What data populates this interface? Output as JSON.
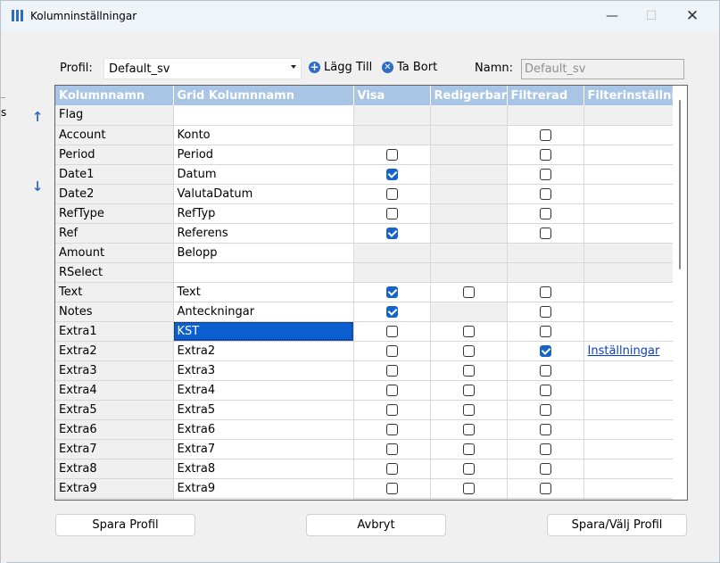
{
  "window": {
    "title": "Kolumninställningar",
    "min_glyph": "—",
    "max_glyph": "☐",
    "close_glyph": "✕"
  },
  "toolbar": {
    "profile_label": "Profil:",
    "profile_value": "Default_sv",
    "add_label": "Lägg Till",
    "remove_label": "Ta Bort",
    "name_label": "Namn:",
    "name_value": "Default_sv"
  },
  "side": {
    "up_glyph": "↑",
    "down_glyph": "↓",
    "strip_glyph": "s"
  },
  "grid": {
    "columns": [
      "Kolumnnamn",
      "Grid Kolumnnamn",
      "Visa",
      "Redigerbar",
      "Filtrerad",
      "Filterinställningar"
    ],
    "rows": [
      {
        "name": "Flag",
        "grid": "",
        "visa": null,
        "redig": null,
        "filt": null,
        "settings": ""
      },
      {
        "name": "Account",
        "grid": "Konto",
        "visa": null,
        "redig": null,
        "filt": false,
        "settings": ""
      },
      {
        "name": "Period",
        "grid": "Period",
        "visa": false,
        "redig": null,
        "filt": false,
        "settings": ""
      },
      {
        "name": "Date1",
        "grid": "Datum",
        "visa": true,
        "redig": null,
        "filt": false,
        "settings": ""
      },
      {
        "name": "Date2",
        "grid": "ValutaDatum",
        "visa": false,
        "redig": null,
        "filt": false,
        "settings": ""
      },
      {
        "name": "RefType",
        "grid": "RefTyp",
        "visa": false,
        "redig": null,
        "filt": false,
        "settings": ""
      },
      {
        "name": "Ref",
        "grid": "Referens",
        "visa": true,
        "redig": null,
        "filt": false,
        "settings": ""
      },
      {
        "name": "Amount",
        "grid": "Belopp",
        "visa": null,
        "redig": null,
        "filt": null,
        "settings": ""
      },
      {
        "name": "RSelect",
        "grid": "",
        "visa": null,
        "redig": null,
        "filt": null,
        "settings": ""
      },
      {
        "name": "Text",
        "grid": "Text",
        "visa": true,
        "redig": false,
        "filt": false,
        "settings": ""
      },
      {
        "name": "Notes",
        "grid": "Anteckningar",
        "visa": true,
        "redig": null,
        "filt": false,
        "settings": ""
      },
      {
        "name": "Extra1",
        "grid": "KST",
        "visa": false,
        "redig": false,
        "filt": false,
        "settings": "",
        "selected": true
      },
      {
        "name": "Extra2",
        "grid": "Extra2",
        "visa": false,
        "redig": false,
        "filt": true,
        "settings": "Inställningar"
      },
      {
        "name": "Extra3",
        "grid": "Extra3",
        "visa": false,
        "redig": false,
        "filt": false,
        "settings": ""
      },
      {
        "name": "Extra4",
        "grid": "Extra4",
        "visa": false,
        "redig": false,
        "filt": false,
        "settings": ""
      },
      {
        "name": "Extra5",
        "grid": "Extra5",
        "visa": false,
        "redig": false,
        "filt": false,
        "settings": ""
      },
      {
        "name": "Extra6",
        "grid": "Extra6",
        "visa": false,
        "redig": false,
        "filt": false,
        "settings": ""
      },
      {
        "name": "Extra7",
        "grid": "Extra7",
        "visa": false,
        "redig": false,
        "filt": false,
        "settings": ""
      },
      {
        "name": "Extra8",
        "grid": "Extra8",
        "visa": false,
        "redig": false,
        "filt": false,
        "settings": ""
      },
      {
        "name": "Extra9",
        "grid": "Extra9",
        "visa": false,
        "redig": false,
        "filt": false,
        "settings": ""
      },
      {
        "name": "",
        "grid": "",
        "visa": null,
        "redig": null,
        "filt": null,
        "settings": ""
      }
    ]
  },
  "footer": {
    "save_profile": "Spara Profil",
    "cancel": "Avbryt",
    "save_select": "Spara/Välj Profil"
  }
}
